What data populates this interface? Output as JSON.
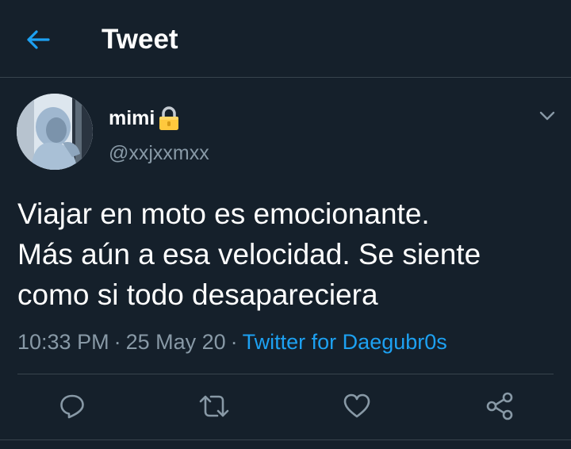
{
  "colors": {
    "background": "#15202b",
    "accent": "#1da1f2",
    "secondary_text": "#8899a6",
    "divider": "#38444d",
    "lock": "#ffc83d"
  },
  "header": {
    "back_icon": "arrow-left-icon",
    "title": "Tweet"
  },
  "tweet": {
    "avatar_icon": "avatar-hooded-person",
    "display_name": "mimi",
    "lock_icon": "lock-emoji-icon",
    "handle": "@xxjxxmxx",
    "more_icon": "chevron-down-icon",
    "text": "Viajar en moto es emocionante.\nMás aún a esa velocidad. Se siente\ncomo si todo desapareciera",
    "time": "10:33 PM",
    "date": "25 May 20",
    "separator": "·",
    "source": "Twitter for Daegubr0s"
  },
  "actions": [
    {
      "name": "reply",
      "icon": "reply-bubble-icon"
    },
    {
      "name": "retweet",
      "icon": "retweet-icon"
    },
    {
      "name": "like",
      "icon": "heart-icon"
    },
    {
      "name": "share",
      "icon": "share-icon"
    }
  ]
}
